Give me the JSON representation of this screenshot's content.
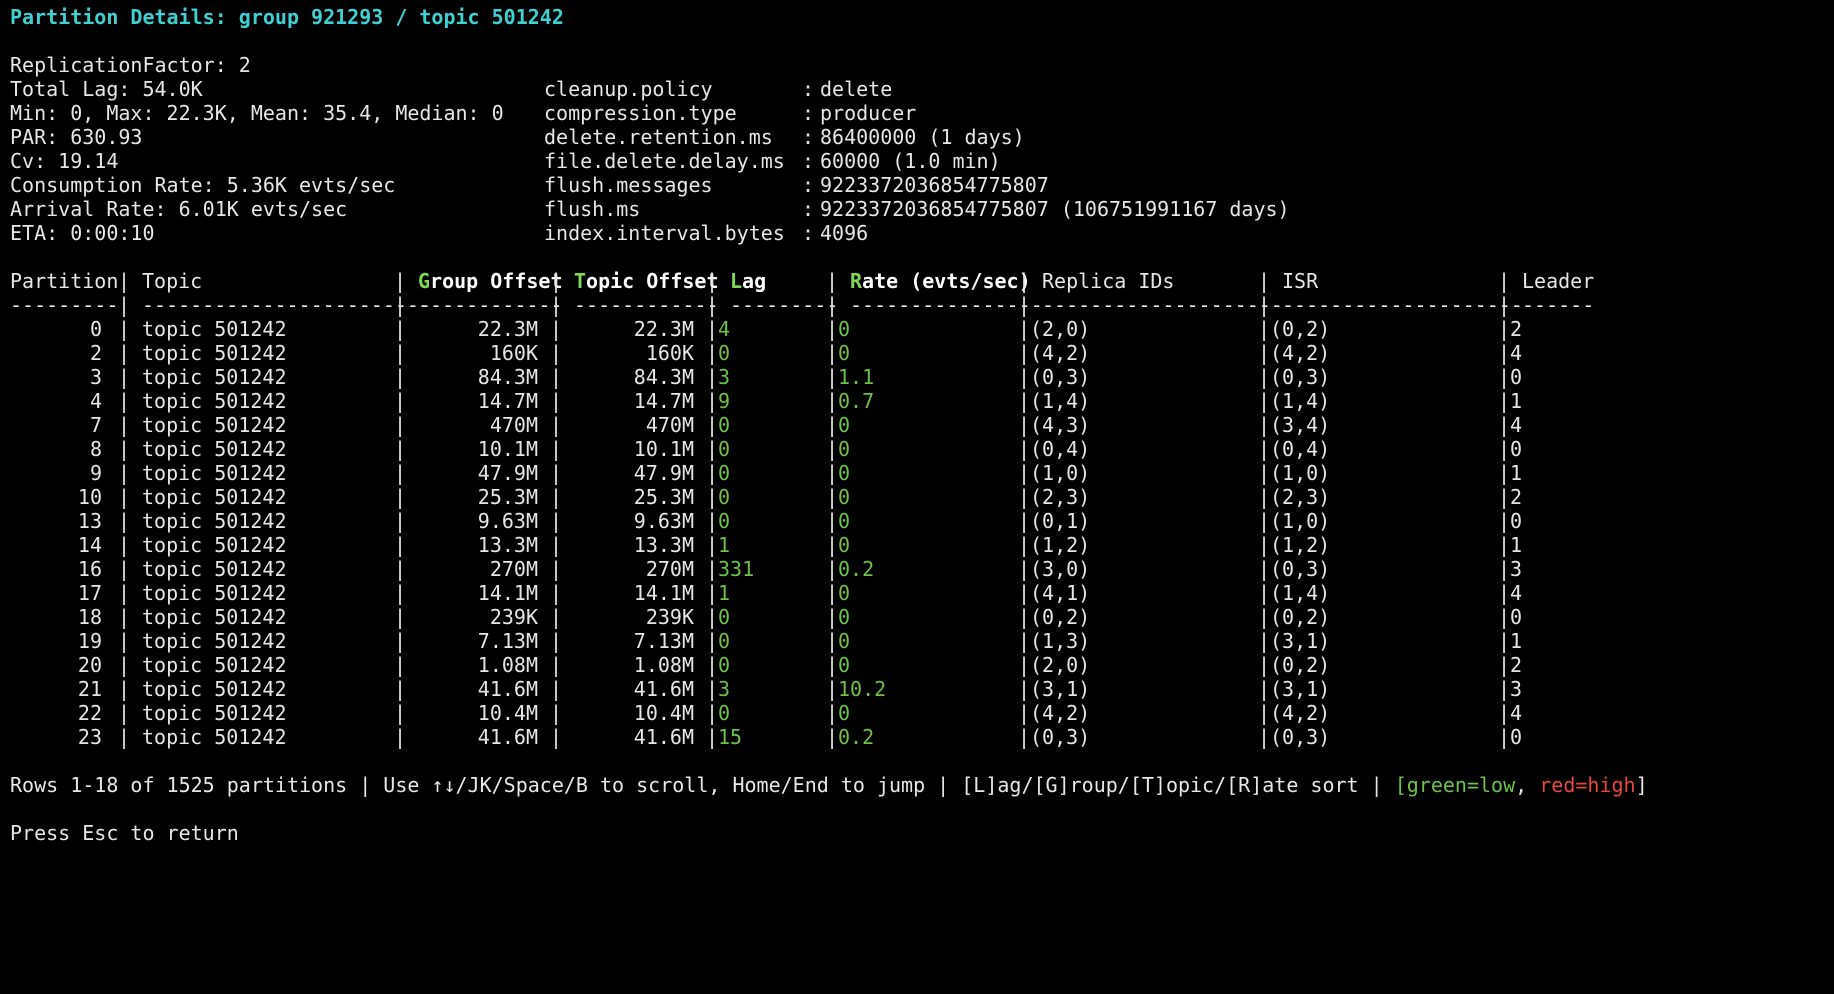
{
  "title": "Partition Details: group 921293 / topic 501242",
  "stats": [
    "ReplicationFactor: 2",
    "Total Lag: 54.0K",
    "Min: 0, Max: 22.3K, Mean: 35.4, Median: 0",
    "PAR: 630.93",
    "Cv: 19.14",
    "Consumption Rate: 5.36K evts/sec",
    "Arrival Rate: 6.01K evts/sec",
    "ETA: 0:00:10"
  ],
  "config": [
    {
      "key": "cleanup.policy",
      "value": "delete"
    },
    {
      "key": "compression.type",
      "value": "producer"
    },
    {
      "key": "delete.retention.ms",
      "value": "86400000 (1 days)"
    },
    {
      "key": "file.delete.delay.ms",
      "value": "60000 (1.0 min)"
    },
    {
      "key": "flush.messages",
      "value": "9223372036854775807"
    },
    {
      "key": "flush.ms",
      "value": "9223372036854775807 (106751991167 days)"
    },
    {
      "key": "index.interval.bytes",
      "value": "4096"
    }
  ],
  "config_sep": ":",
  "table": {
    "col_sep": "|",
    "headers": {
      "partition": "Partition",
      "topic": "Topic",
      "group_offset_key": "G",
      "group_offset_rest": "roup Offset",
      "topic_offset_key": "T",
      "topic_offset_rest": "opic Offset",
      "lag_key": "L",
      "lag_rest": "ag",
      "rate_key": "R",
      "rate_rest": "ate (evts/sec)",
      "replica_ids": "Replica IDs",
      "isr": "ISR",
      "leader": "Leader"
    },
    "dashes": {
      "partition": "---------",
      "topic": "------------------------",
      "group_offset": "------------",
      "topic_offset": "------------",
      "lag": "---------",
      "rate": "----------------",
      "replica_ids": "--------------------",
      "isr": "--------------------",
      "leader": "------"
    },
    "rows": [
      {
        "partition": "0",
        "topic": "topic 501242",
        "group_offset": "22.3M",
        "topic_offset": "22.3M",
        "lag": "4",
        "rate": "0",
        "replica_ids": "(2,0)",
        "isr": "(0,2)",
        "leader": "2"
      },
      {
        "partition": "2",
        "topic": "topic 501242",
        "group_offset": "160K",
        "topic_offset": "160K",
        "lag": "0",
        "rate": "0",
        "replica_ids": "(4,2)",
        "isr": "(4,2)",
        "leader": "4"
      },
      {
        "partition": "3",
        "topic": "topic 501242",
        "group_offset": "84.3M",
        "topic_offset": "84.3M",
        "lag": "3",
        "rate": "1.1",
        "replica_ids": "(0,3)",
        "isr": "(0,3)",
        "leader": "0"
      },
      {
        "partition": "4",
        "topic": "topic 501242",
        "group_offset": "14.7M",
        "topic_offset": "14.7M",
        "lag": "9",
        "rate": "0.7",
        "replica_ids": "(1,4)",
        "isr": "(1,4)",
        "leader": "1"
      },
      {
        "partition": "7",
        "topic": "topic 501242",
        "group_offset": "470M",
        "topic_offset": "470M",
        "lag": "0",
        "rate": "0",
        "replica_ids": "(4,3)",
        "isr": "(3,4)",
        "leader": "4"
      },
      {
        "partition": "8",
        "topic": "topic 501242",
        "group_offset": "10.1M",
        "topic_offset": "10.1M",
        "lag": "0",
        "rate": "0",
        "replica_ids": "(0,4)",
        "isr": "(0,4)",
        "leader": "0"
      },
      {
        "partition": "9",
        "topic": "topic 501242",
        "group_offset": "47.9M",
        "topic_offset": "47.9M",
        "lag": "0",
        "rate": "0",
        "replica_ids": "(1,0)",
        "isr": "(1,0)",
        "leader": "1"
      },
      {
        "partition": "10",
        "topic": "topic 501242",
        "group_offset": "25.3M",
        "topic_offset": "25.3M",
        "lag": "0",
        "rate": "0",
        "replica_ids": "(2,3)",
        "isr": "(2,3)",
        "leader": "2"
      },
      {
        "partition": "13",
        "topic": "topic 501242",
        "group_offset": "9.63M",
        "topic_offset": "9.63M",
        "lag": "0",
        "rate": "0",
        "replica_ids": "(0,1)",
        "isr": "(1,0)",
        "leader": "0"
      },
      {
        "partition": "14",
        "topic": "topic 501242",
        "group_offset": "13.3M",
        "topic_offset": "13.3M",
        "lag": "1",
        "rate": "0",
        "replica_ids": "(1,2)",
        "isr": "(1,2)",
        "leader": "1"
      },
      {
        "partition": "16",
        "topic": "topic 501242",
        "group_offset": "270M",
        "topic_offset": "270M",
        "lag": "331",
        "rate": "0.2",
        "replica_ids": "(3,0)",
        "isr": "(0,3)",
        "leader": "3"
      },
      {
        "partition": "17",
        "topic": "topic 501242",
        "group_offset": "14.1M",
        "topic_offset": "14.1M",
        "lag": "1",
        "rate": "0",
        "replica_ids": "(4,1)",
        "isr": "(1,4)",
        "leader": "4"
      },
      {
        "partition": "18",
        "topic": "topic 501242",
        "group_offset": "239K",
        "topic_offset": "239K",
        "lag": "0",
        "rate": "0",
        "replica_ids": "(0,2)",
        "isr": "(0,2)",
        "leader": "0"
      },
      {
        "partition": "19",
        "topic": "topic 501242",
        "group_offset": "7.13M",
        "topic_offset": "7.13M",
        "lag": "0",
        "rate": "0",
        "replica_ids": "(1,3)",
        "isr": "(3,1)",
        "leader": "1"
      },
      {
        "partition": "20",
        "topic": "topic 501242",
        "group_offset": "1.08M",
        "topic_offset": "1.08M",
        "lag": "0",
        "rate": "0",
        "replica_ids": "(2,0)",
        "isr": "(0,2)",
        "leader": "2"
      },
      {
        "partition": "21",
        "topic": "topic 501242",
        "group_offset": "41.6M",
        "topic_offset": "41.6M",
        "lag": "3",
        "rate": "10.2",
        "replica_ids": "(3,1)",
        "isr": "(3,1)",
        "leader": "3"
      },
      {
        "partition": "22",
        "topic": "topic 501242",
        "group_offset": "10.4M",
        "topic_offset": "10.4M",
        "lag": "0",
        "rate": "0",
        "replica_ids": "(4,2)",
        "isr": "(4,2)",
        "leader": "4"
      },
      {
        "partition": "23",
        "topic": "topic 501242",
        "group_offset": "41.6M",
        "topic_offset": "41.6M",
        "lag": "15",
        "rate": "0.2",
        "replica_ids": "(0,3)",
        "isr": "(0,3)",
        "leader": "0"
      }
    ]
  },
  "footer": {
    "status": "Rows 1-18 of 1525 partitions | Use ↑↓/JK/Space/B to scroll, Home/End to jump | [L]ag/[G]roup/[T]opic/[R]ate sort | ",
    "legend_open": "[",
    "legend_green": "green=low",
    "legend_comma": ", ",
    "legend_red": "red=high",
    "legend_close": "]",
    "press_esc": "Press Esc to return"
  },
  "colors": {
    "background": "#000000",
    "foreground": "#e6e6e6",
    "title": "#3fd0d4",
    "low": "#6cc24a",
    "high": "#e5483b"
  }
}
